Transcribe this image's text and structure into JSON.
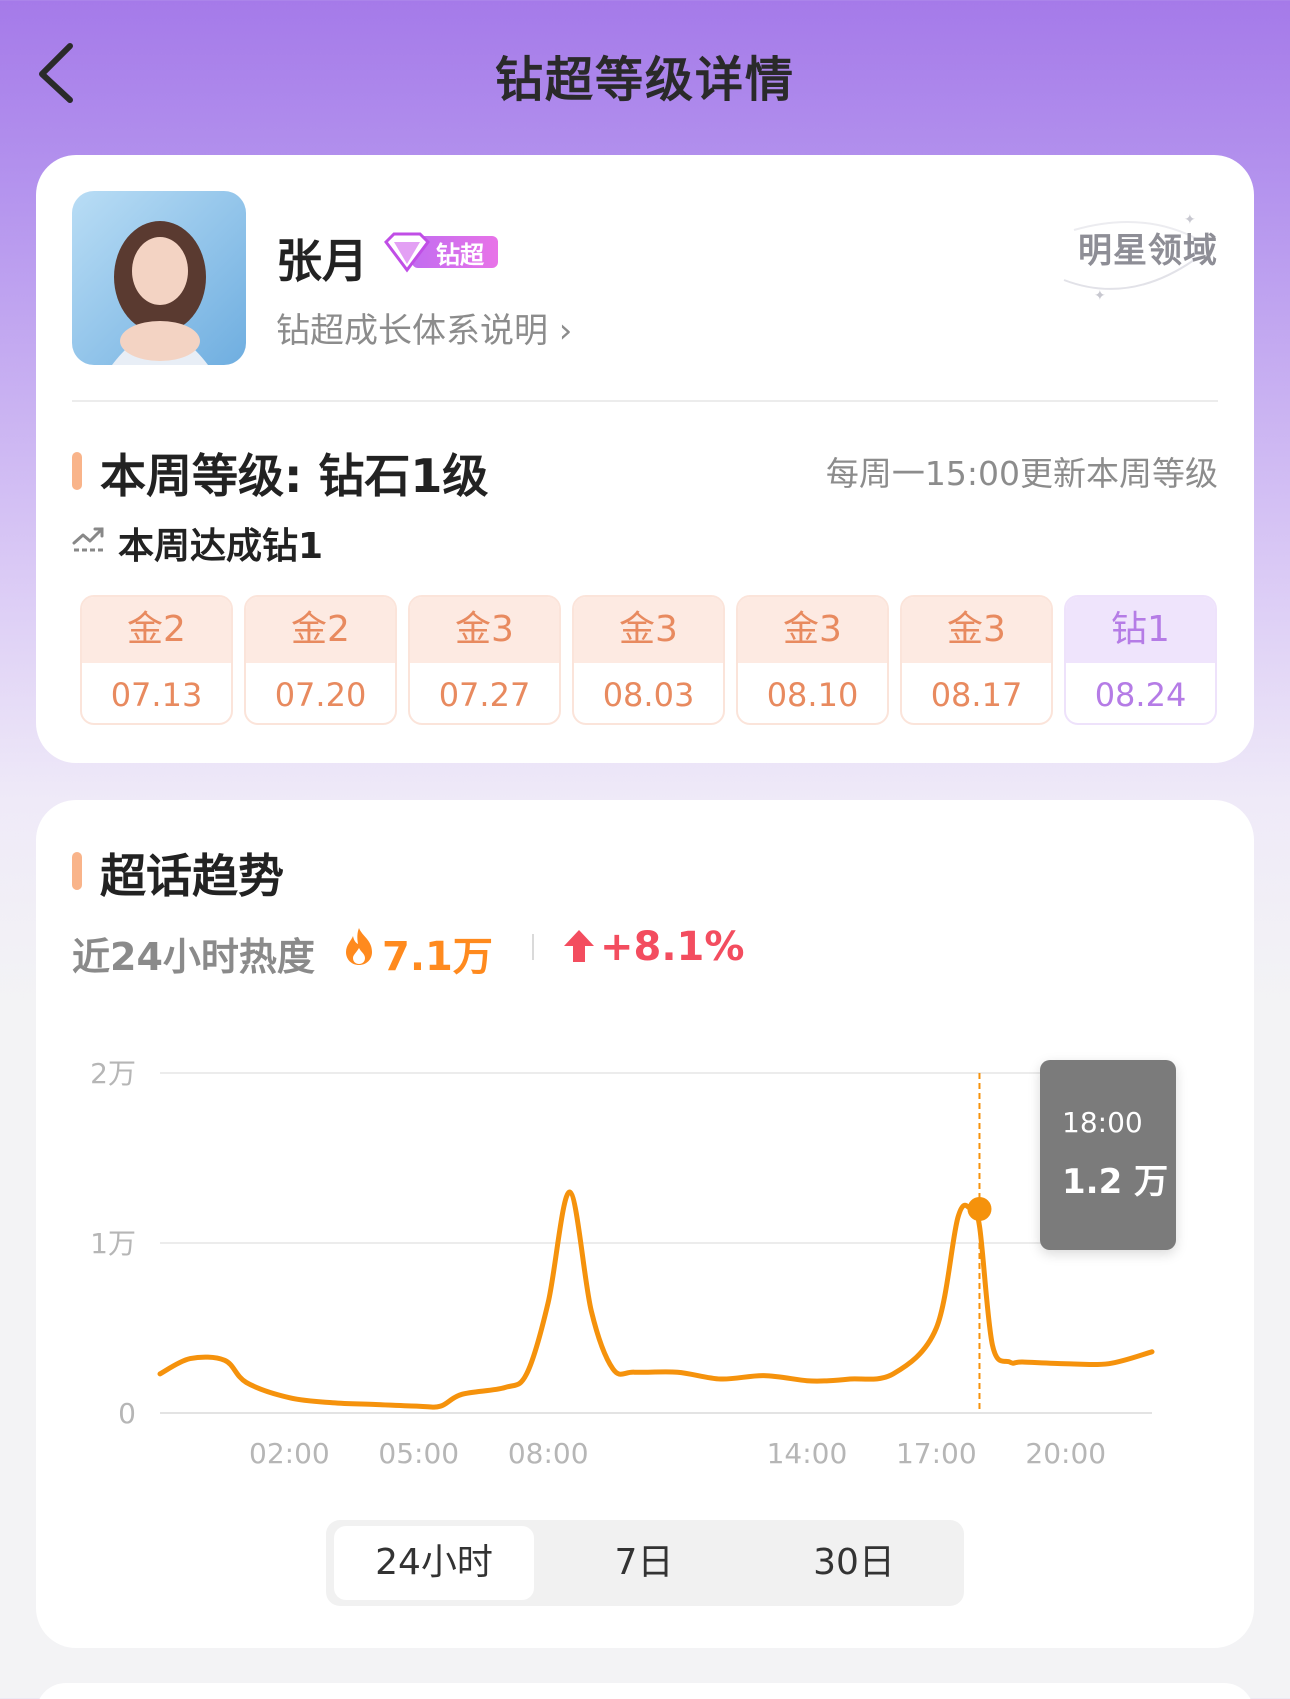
{
  "header": {
    "title": "钻超等级详情"
  },
  "profile": {
    "name": "张月",
    "badge_label": "钻超",
    "growth_link": "钻超成长体系说明",
    "domain_label": "明星领域"
  },
  "level": {
    "title": "本周等级: 钻石1级",
    "update_note": "每周一15:00更新本周等级",
    "achievement": "本周达成钻1",
    "weeks": [
      {
        "level": "金2",
        "date": "07.13"
      },
      {
        "level": "金2",
        "date": "07.20"
      },
      {
        "level": "金3",
        "date": "07.27"
      },
      {
        "level": "金3",
        "date": "08.03"
      },
      {
        "level": "金3",
        "date": "08.10"
      },
      {
        "level": "金3",
        "date": "08.17"
      },
      {
        "level": "钻1",
        "date": "08.24"
      }
    ]
  },
  "trend": {
    "title": "超话趋势",
    "heat_label": "近24小时热度",
    "heat_value": "7.1万",
    "heat_change": "+8.1%",
    "tooltip": {
      "time": "18:00",
      "value": "1.2 万"
    },
    "range_tabs": [
      "24小时",
      "7日",
      "30日"
    ],
    "active_range": "24小时"
  },
  "chart_data": {
    "type": "line",
    "yticks": [
      "0",
      "1万",
      "2万"
    ],
    "ylim": [
      0,
      20000
    ],
    "xticks": [
      "02:00",
      "05:00",
      "08:00",
      "14:00",
      "17:00",
      "20:00"
    ],
    "xlim": [
      -1,
      22
    ],
    "x": [
      -1,
      -0.3,
      0.5,
      1.0,
      2.0,
      3.0,
      4.0,
      5.0,
      5.5,
      6.0,
      7.0,
      7.5,
      8.0,
      8.5,
      9.0,
      9.5,
      10.0,
      11.0,
      12.0,
      13.0,
      14.0,
      14.5,
      15.0,
      16.0,
      17.0,
      17.5,
      17.8,
      18.0,
      18.3,
      18.7,
      19.0,
      20.0,
      21.0,
      22.0
    ],
    "y": [
      2300,
      3200,
      3100,
      1800,
      900,
      600,
      500,
      400,
      400,
      1100,
      1500,
      2300,
      6500,
      13000,
      6000,
      2600,
      2400,
      2400,
      2000,
      2200,
      1900,
      1900,
      2000,
      2300,
      5000,
      11500,
      12000,
      11000,
      4000,
      3000,
      3000,
      2900,
      2900,
      3600
    ],
    "grid": true,
    "highlight": {
      "x": 18.0,
      "y": 12000
    },
    "color": "#f5920c"
  }
}
